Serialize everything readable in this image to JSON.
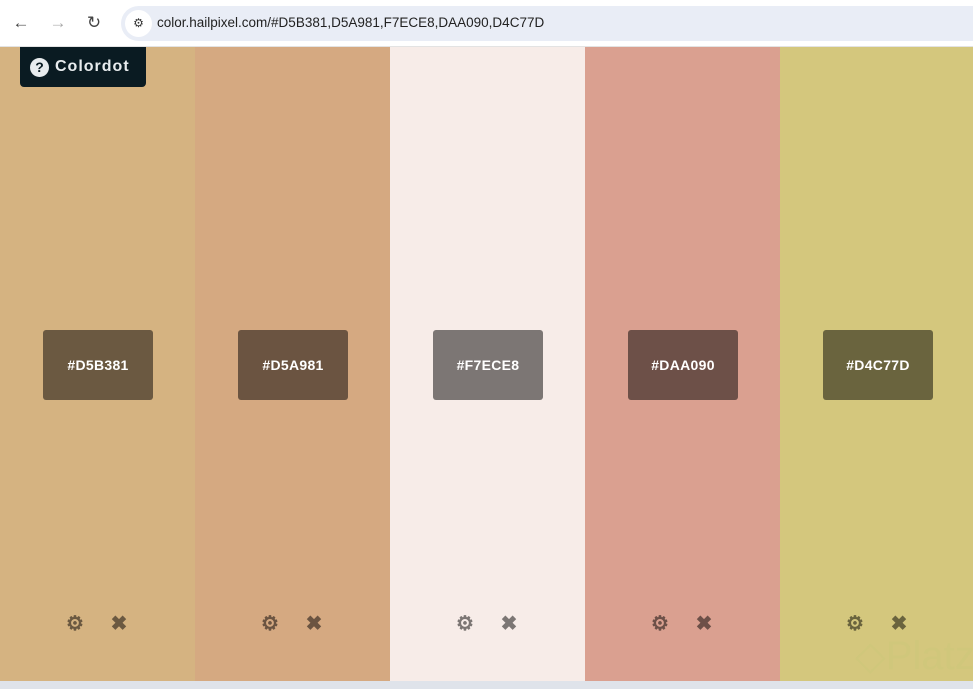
{
  "browser": {
    "url": "color.hailpixel.com/#D5B381,D5A981,F7ECE8,DAA090,D4C77D"
  },
  "app": {
    "logo_label": "Colordot"
  },
  "swatches": [
    {
      "hex": "#D5B381",
      "bg": "#d5b381",
      "chip": "#6b5941",
      "icon": "#6b5941"
    },
    {
      "hex": "#D5A981",
      "bg": "#d5a981",
      "chip": "#6b5441",
      "icon": "#6b5441"
    },
    {
      "hex": "#F7ECE8",
      "bg": "#f7ece8",
      "chip": "#7c7674",
      "icon": "#7c7674"
    },
    {
      "hex": "#DAA090",
      "bg": "#daa090",
      "chip": "#6d5048",
      "icon": "#6d5048"
    },
    {
      "hex": "#D4C77D",
      "bg": "#d4c77d",
      "chip": "#6a643e",
      "icon": "#6a643e"
    }
  ],
  "watermark": "Platzi"
}
